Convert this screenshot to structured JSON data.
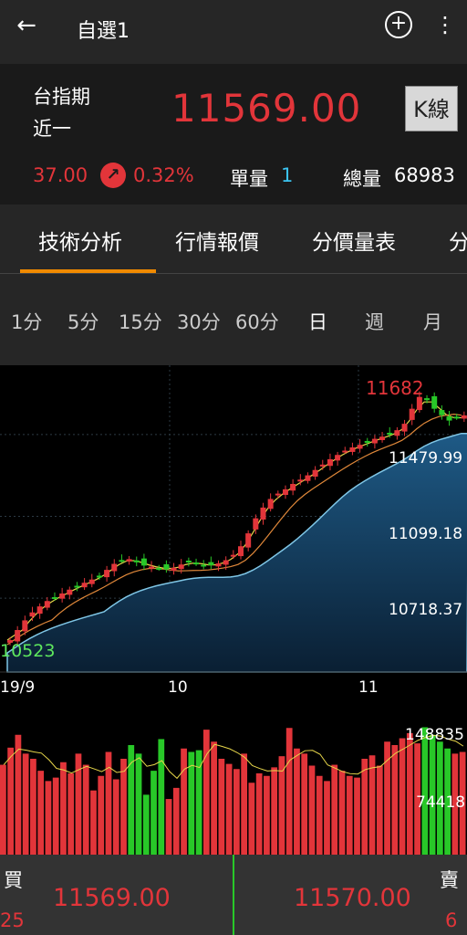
{
  "header": {
    "title": "自選1",
    "back_icon": "arrow-left-icon",
    "add_icon": "plus-circle-icon",
    "menu_icon": "more-vert-icon"
  },
  "quote": {
    "symbol_line1": "台指期",
    "symbol_line2": "近一",
    "price": "11569.00",
    "kline_button": "K線",
    "change": "37.00",
    "change_pct": "0.32%",
    "unit_volume_label": "單量",
    "unit_volume": "1",
    "total_volume_label": "總量",
    "total_volume": "68983",
    "up_color": "#e2353a",
    "down_color": "#28c828"
  },
  "tabs": [
    {
      "label": "技術分析",
      "active": true
    },
    {
      "label": "行情報價",
      "active": false
    },
    {
      "label": "分價量表",
      "active": false
    },
    {
      "label": "分",
      "active": false
    }
  ],
  "periods": [
    {
      "label": "1分"
    },
    {
      "label": "5分"
    },
    {
      "label": "15分"
    },
    {
      "label": "30分"
    },
    {
      "label": "60分"
    },
    {
      "label": "日",
      "active": true
    },
    {
      "label": "週"
    },
    {
      "label": "月"
    }
  ],
  "price_chart": {
    "high_label": "11682",
    "low_label": "10523",
    "y_labels": [
      "11479.99",
      "11099.18",
      "10718.37"
    ],
    "x_labels": [
      "19/9",
      "10",
      "11"
    ]
  },
  "volume_chart": {
    "y_labels": [
      "148835",
      "74418"
    ]
  },
  "chart_data": {
    "type": "candlestick",
    "ylim": [
      10400,
      11760
    ],
    "y_ticks": [
      11479.99,
      11099.18,
      10718.37
    ],
    "x_ticks": [
      "19/9",
      "10",
      "11"
    ],
    "high": 11682,
    "low": 10523,
    "closes": [
      10523,
      10570,
      10615,
      10652,
      10680,
      10705,
      10722,
      10740,
      10758,
      10775,
      10790,
      10805,
      10822,
      10850,
      10878,
      10895,
      10900,
      10885,
      10870,
      10865,
      10858,
      10852,
      10860,
      10875,
      10890,
      10880,
      10868,
      10872,
      10880,
      10895,
      10920,
      10960,
      11020,
      11090,
      11140,
      11180,
      11205,
      11225,
      11250,
      11270,
      11290,
      11315,
      11340,
      11365,
      11385,
      11405,
      11420,
      11432,
      11445,
      11460,
      11470,
      11480,
      11500,
      11530,
      11600,
      11655,
      11640,
      11600,
      11570,
      11545,
      11560,
      11569
    ],
    "volume_ylim": [
      0,
      160000
    ],
    "volume_ticks": [
      148835,
      74418
    ],
    "volumes": [
      105000,
      125000,
      140000,
      118000,
      112000,
      98000,
      86000,
      90000,
      108000,
      95000,
      118000,
      105000,
      75000,
      92000,
      120000,
      88000,
      112000,
      128000,
      118000,
      70000,
      98000,
      135000,
      65000,
      78000,
      124000,
      120000,
      122000,
      146000,
      132000,
      112000,
      106000,
      100000,
      118000,
      84000,
      95000,
      92000,
      102000,
      115000,
      148000,
      124000,
      118000,
      104000,
      92000,
      86000,
      105000,
      98000,
      92000,
      90000,
      112000,
      116000,
      104000,
      132000,
      128000,
      136000,
      142000,
      130000,
      148835,
      140000,
      132000,
      124000,
      118000,
      120000
    ]
  }
}
